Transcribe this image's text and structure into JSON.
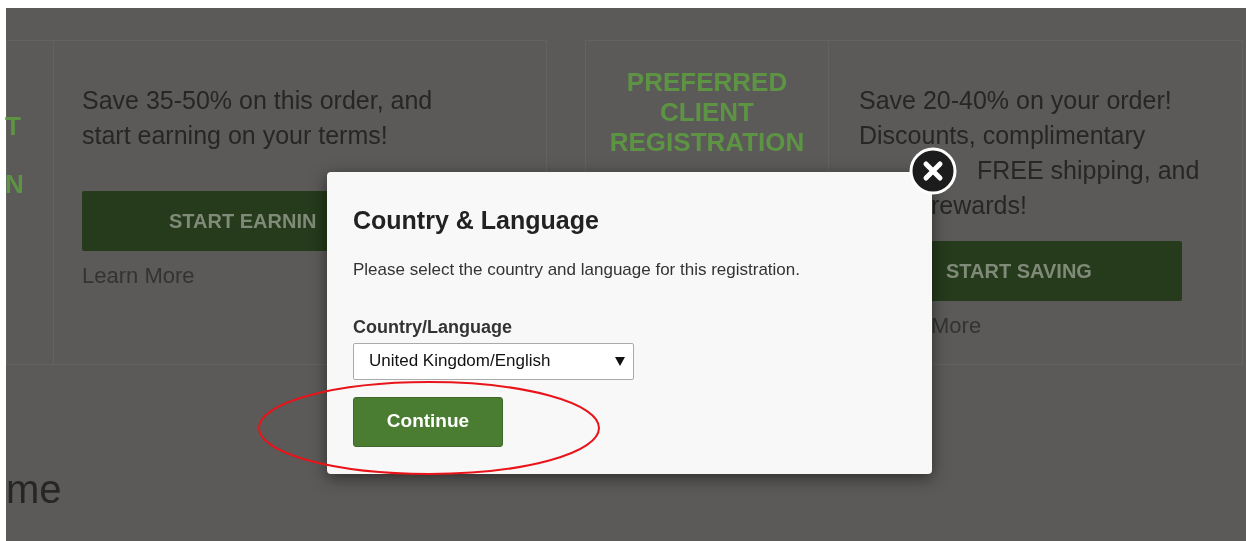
{
  "cards": [
    {
      "heading_lines": [
        "T",
        "N"
      ],
      "body_lines": [
        "Save 35-50% on this order, and",
        "start earning on your terms!"
      ],
      "button": "START EARNIN",
      "link": "Learn More"
    },
    {
      "heading_lines": [
        "PREFERRED",
        "CLIENT",
        "REGISTRATION"
      ],
      "body_lines": [
        "Save 20-40% on your order!",
        "Discounts, complimentary",
        "FREE shipping, and",
        "rewards!"
      ],
      "button": "START SAVING",
      "link": "More"
    }
  ],
  "section_heading": "me",
  "dialog": {
    "title": "Country & Language",
    "description": "Please select the country and language for this registration.",
    "field_label": "Country/Language",
    "select_value": "United Kingdom/English",
    "button": "Continue"
  }
}
